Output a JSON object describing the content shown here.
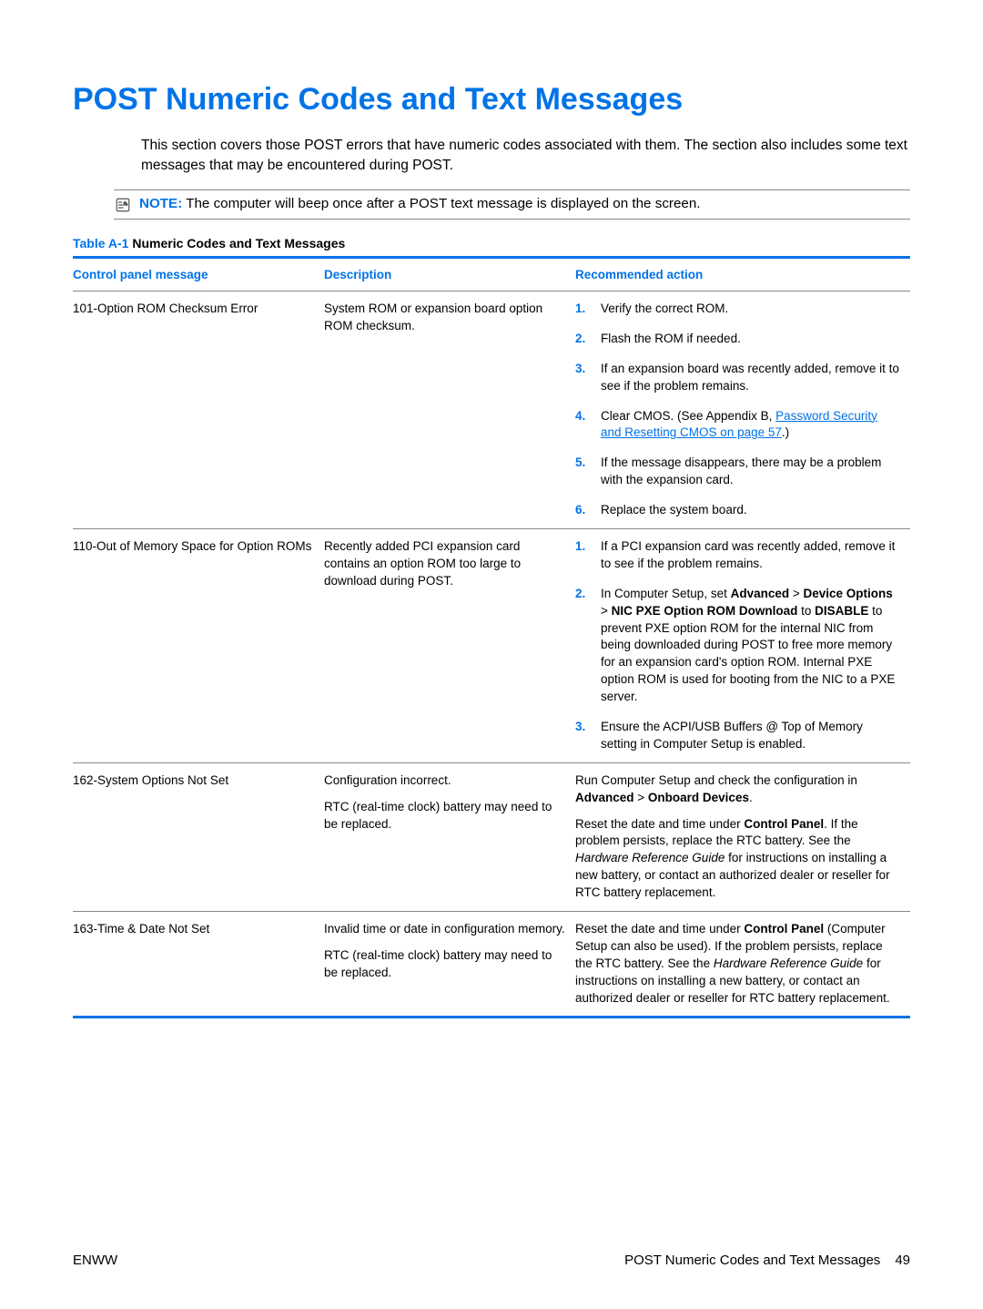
{
  "heading": "POST Numeric Codes and Text Messages",
  "intro": "This section covers those POST errors that have numeric codes associated with them. The section also includes some text messages that may be encountered during POST.",
  "note": {
    "label": "NOTE:",
    "text": "The computer will beep once after a POST text message is displayed on the screen."
  },
  "table_title": {
    "prefix": "Table A-1",
    "rest": "  Numeric Codes and Text Messages"
  },
  "columns": {
    "msg": "Control panel message",
    "desc": "Description",
    "act": "Recommended action"
  },
  "rows": {
    "r1": {
      "msg": "101-Option ROM Checksum Error",
      "desc": "System ROM or expansion board option ROM checksum.",
      "steps": {
        "s1": "Verify the correct ROM.",
        "s2": "Flash the ROM if needed.",
        "s3": "If an expansion board was recently added, remove it to see if the problem remains.",
        "s4a": "Clear CMOS. (See Appendix B, ",
        "s4link": "Password Security and Resetting CMOS on page 57",
        "s4b": ".)",
        "s5": "If the message disappears, there may be a problem with the expansion card.",
        "s6": "Replace the system board."
      }
    },
    "r2": {
      "msg": "110-Out of Memory Space for Option ROMs",
      "desc": "Recently added PCI expansion card contains an option ROM too large to download during POST.",
      "steps": {
        "s1": "If a PCI expansion card was recently added, remove it to see if the problem remains.",
        "s2_a": "In Computer Setup, set ",
        "s2_b1": "Advanced",
        "s2_gt1": " > ",
        "s2_b2": "Device Options",
        "s2_gt2": " > ",
        "s2_b3": "NIC PXE Option ROM Download",
        "s2_mid": " to ",
        "s2_b4": "DISABLE",
        "s2_c": " to prevent PXE option ROM for the internal NIC from being downloaded during POST to free more memory for an expansion card's option ROM. Internal PXE option ROM is used for booting from the NIC to a PXE server.",
        "s3": "Ensure the ACPI/USB Buffers @ Top of Memory setting in Computer Setup is enabled."
      }
    },
    "r3": {
      "msg": "162-System Options Not Set",
      "desc_p1": "Configuration incorrect.",
      "desc_p2": "RTC (real-time clock) battery may need to be replaced.",
      "act_p1_a": "Run Computer Setup and check the configuration in ",
      "act_p1_b1": "Advanced",
      "act_p1_gt": " > ",
      "act_p1_b2": "Onboard Devices",
      "act_p1_c": ".",
      "act_p2_a": "Reset the date and time under ",
      "act_p2_b": "Control Panel",
      "act_p2_c": ". If the problem persists, replace the RTC battery. See the ",
      "act_p2_i": "Hardware Reference Guide",
      "act_p2_d": " for instructions on installing a new battery, or contact an authorized dealer or reseller for RTC battery replacement."
    },
    "r4": {
      "msg": "163-Time & Date Not Set",
      "desc_p1": "Invalid time or date in configuration memory.",
      "desc_p2": "RTC (real-time clock) battery may need to be replaced.",
      "act_a": "Reset the date and time under ",
      "act_b": "Control Panel",
      "act_c": " (Computer Setup can also be used). If the problem persists, replace the RTC battery. See the ",
      "act_i": "Hardware Reference Guide",
      "act_d": " for instructions on installing a new battery, or contact an authorized dealer or reseller for RTC battery replacement."
    }
  },
  "footer": {
    "left": "ENWW",
    "right_text": "POST Numeric Codes and Text Messages",
    "page": "49"
  }
}
